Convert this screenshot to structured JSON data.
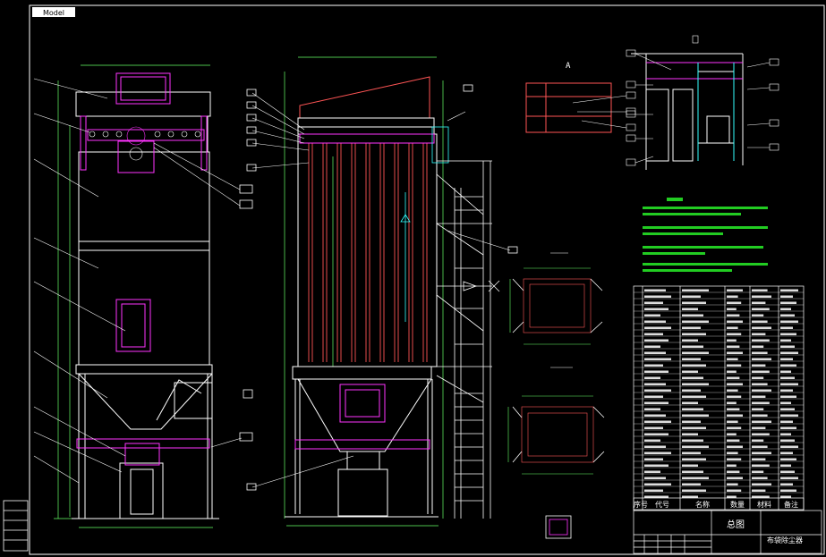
{
  "viewer": {
    "tab_label": "Model"
  },
  "drawing": {
    "title_block": {
      "drawing_name": "总图",
      "product_name": "布袋除尘器"
    },
    "parts_header": [
      "序号",
      "代号",
      "名称",
      "数量",
      "材料",
      "备注"
    ],
    "section_labels": {
      "side_view": "A",
      "detail_view": "B"
    }
  },
  "colors": {
    "background": "#000000",
    "structure": "#ffffff",
    "bags": "#ff5555",
    "frames": "#ff33ff",
    "dimensions": "#66ff66",
    "outline_cyan": "#33ffff",
    "notes_green": "#22cc22"
  }
}
